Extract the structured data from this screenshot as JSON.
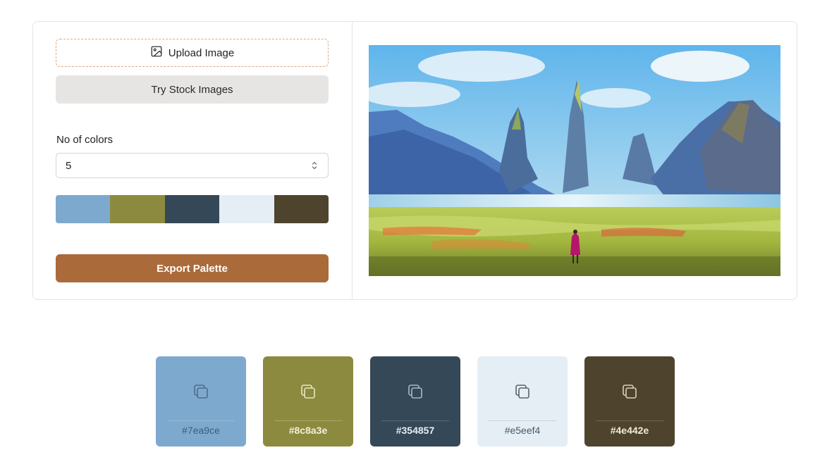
{
  "controls": {
    "upload_label": "Upload Image",
    "upload_icon": "image-icon",
    "stock_label": "Try Stock Images",
    "count_label": "No of colors",
    "count_value": "5",
    "export_label": "Export Palette"
  },
  "preview": {
    "icon": "landscape-painting"
  },
  "palette": [
    {
      "hex": "#7ea9ce",
      "text_color": "#3e5a78",
      "line_color": "#9ab9d8",
      "icon_color": "#4c6b8e",
      "bold": false
    },
    {
      "hex": "#8c8a3e",
      "text_color": "#f2f0d8",
      "line_color": "#a9a766",
      "icon_color": "#e8e6c6",
      "bold": true
    },
    {
      "hex": "#354857",
      "text_color": "#e6eef5",
      "line_color": "#57697a",
      "icon_color": "#aab8c4",
      "bold": true
    },
    {
      "hex": "#e5eef4",
      "text_color": "#4a5662",
      "line_color": "#c5d0d9",
      "icon_color": "#56636f",
      "bold": false
    },
    {
      "hex": "#4e442e",
      "text_color": "#f0ead9",
      "line_color": "#6f664f",
      "icon_color": "#d8d0bc",
      "bold": true
    }
  ],
  "colors": {
    "accent": "#ab6a3a",
    "upload_border": "#e0a880",
    "stock_bg": "#e6e5e3"
  }
}
